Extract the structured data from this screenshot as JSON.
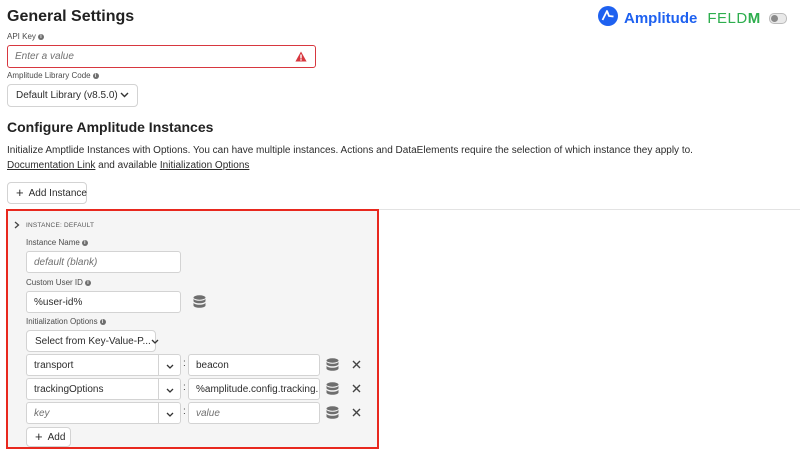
{
  "header": {
    "title": "General Settings",
    "brand_amplitude": "Amplitude",
    "brand_feld": "FELD",
    "brand_m": "M"
  },
  "api_key": {
    "label": "API Key",
    "placeholder": "Enter a value"
  },
  "library": {
    "label": "Amplitude Library Code",
    "value": "Default Library (v8.5.0)"
  },
  "instances": {
    "heading": "Configure Amplitude Instances",
    "description": "Initialize Amptlide Instances with Options. You can have multiple instances. Actions and DataElements require the selection of which instance they apply to.",
    "doc_link": "Documentation Link",
    "and_text": " and available ",
    "init_link": "Initialization Options",
    "add_instance": "Add Instance"
  },
  "instance": {
    "header": "INSTANCE: DEFAULT",
    "name_label": "Instance Name",
    "name_placeholder": "default (blank)",
    "user_id_label": "Custom User ID",
    "user_id_value": "%user-id%",
    "init_label": "Initialization Options",
    "select_kv": "Select from Key-Value-P...",
    "rows": [
      {
        "key": "transport",
        "value": "beacon"
      },
      {
        "key": "trackingOptions",
        "value": "%amplitude.config.tracking..."
      },
      {
        "key": "key",
        "value": "value"
      }
    ],
    "add": "Add"
  },
  "colors": {
    "accent_blue": "#1e61f0",
    "feld_green": "#2eae4e",
    "error_red": "#d7373f",
    "highlight_red": "#e8281e"
  }
}
